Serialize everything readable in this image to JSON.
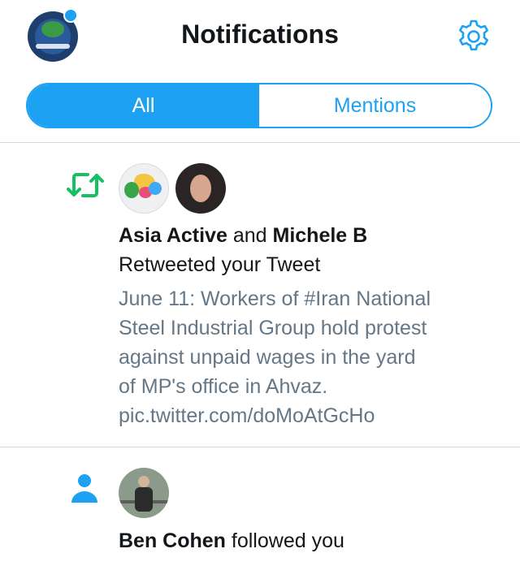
{
  "header": {
    "title": "Notifications",
    "tabs": [
      {
        "label": "All",
        "active": true
      },
      {
        "label": "Mentions",
        "active": false
      }
    ]
  },
  "notifications": [
    {
      "type": "retweet",
      "icon": "retweet-icon",
      "actors": [
        "Asia Active",
        "Michele B"
      ],
      "connector": "and",
      "action": "Retweeted your Tweet",
      "tweet_lines": [
        "June 11: Workers of #Iran National",
        "Steel Industrial Group hold protest",
        "against unpaid wages in the yard",
        "of MP's office in Ahvaz.",
        "pic.twitter.com/doMoAtGcHo"
      ]
    },
    {
      "type": "follow",
      "icon": "person-icon",
      "actor": "Ben Cohen",
      "action": "followed you"
    }
  ],
  "colors": {
    "accent": "#1da1f2",
    "retweet": "#17bf63",
    "muted_text": "#657786",
    "divider": "#d6d9dc"
  }
}
